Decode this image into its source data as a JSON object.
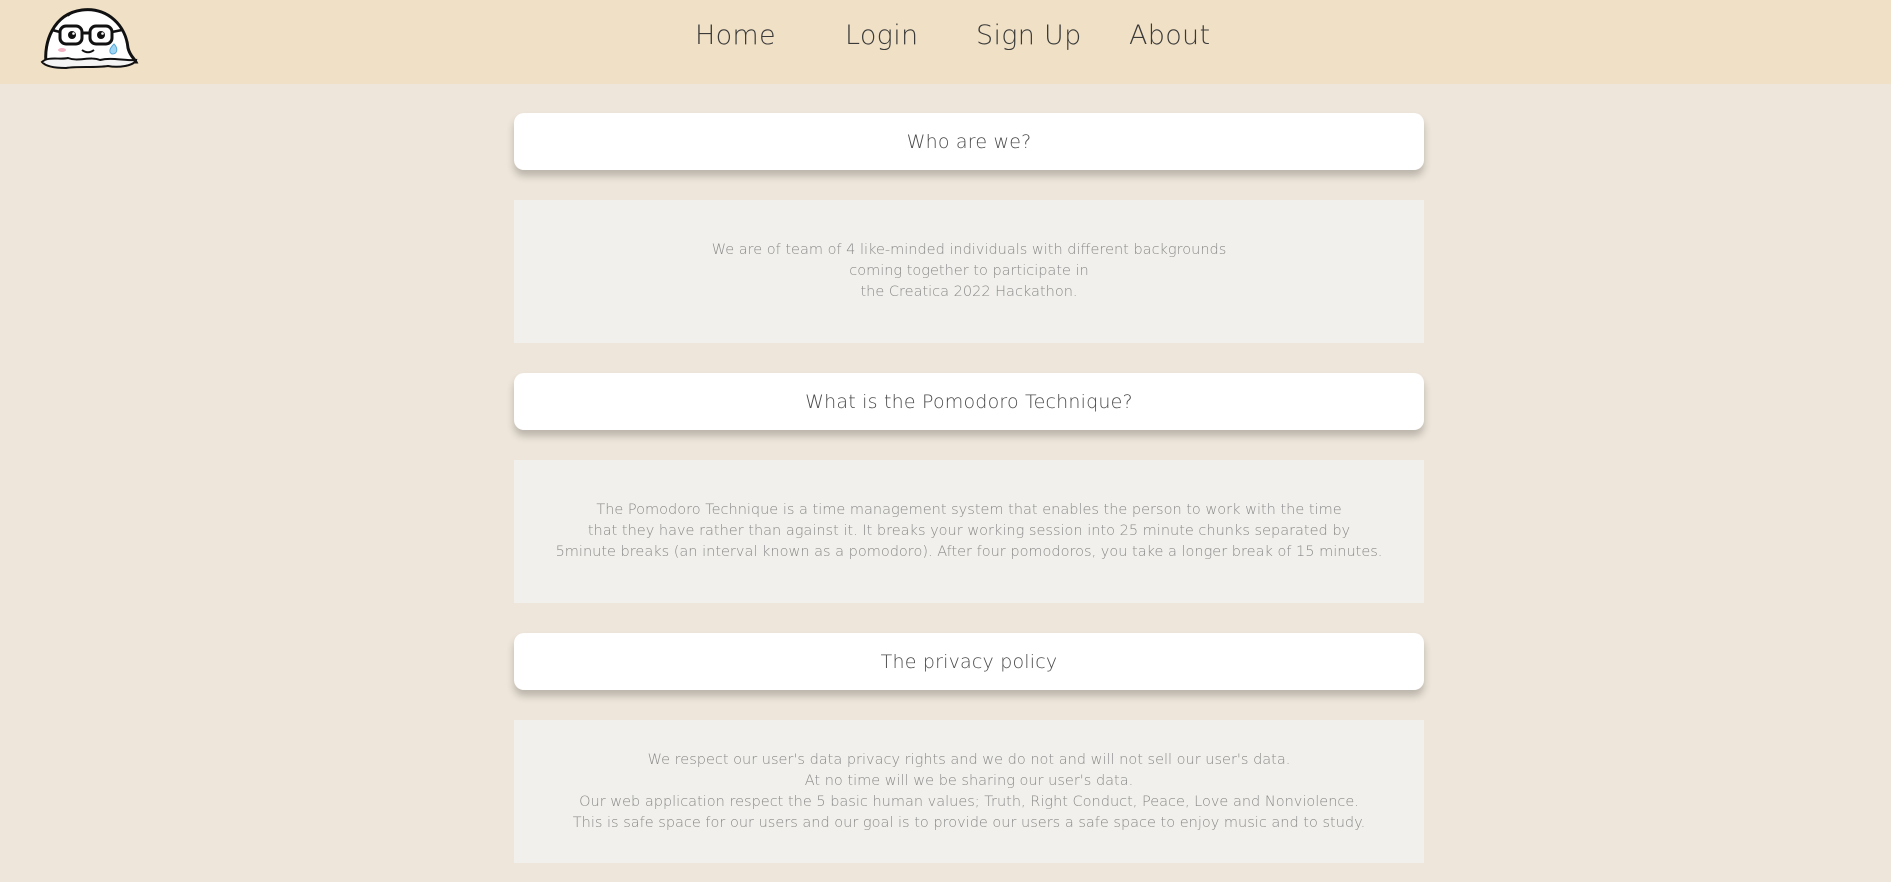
{
  "nav": {
    "logo_icon": "nerd-cartoon-face-icon",
    "links": [
      {
        "label": "Home"
      },
      {
        "label": "Login"
      },
      {
        "label": "Sign Up"
      },
      {
        "label": "About"
      }
    ]
  },
  "sections": [
    {
      "title": "Who are we?",
      "lines": [
        "We are of team of 4 like-minded individuals with different backgrounds",
        "coming together to participate in",
        "the Creatica 2022 Hackathon."
      ]
    },
    {
      "title": "What is the Pomodoro Technique?",
      "lines": [
        "The Pomodoro Technique is a time management system that enables the person to work with the time",
        "that they have rather than against it. It breaks your working session into 25 minute chunks separated by",
        "5minute breaks (an interval known as a pomodoro). After four pomodoros, you take a longer break of 15 minutes."
      ]
    },
    {
      "title": "The privacy policy",
      "lines": [
        "We respect our user's data privacy rights and we do not and will not sell our user's data.",
        "At no time will we be sharing our user's data.",
        "Our web application respect the 5 basic human values; Truth, Right Conduct, Peace, Love and Nonviolence.",
        "This is safe space for our users and our goal is to provide our users a safe space to enjoy music and to study."
      ]
    }
  ],
  "colors": {
    "page_background": "#EEE6DA",
    "navbar_background": "#F0E0C5",
    "card_background": "#FFFFFF",
    "body_panel_background": "#F1F0EC"
  }
}
